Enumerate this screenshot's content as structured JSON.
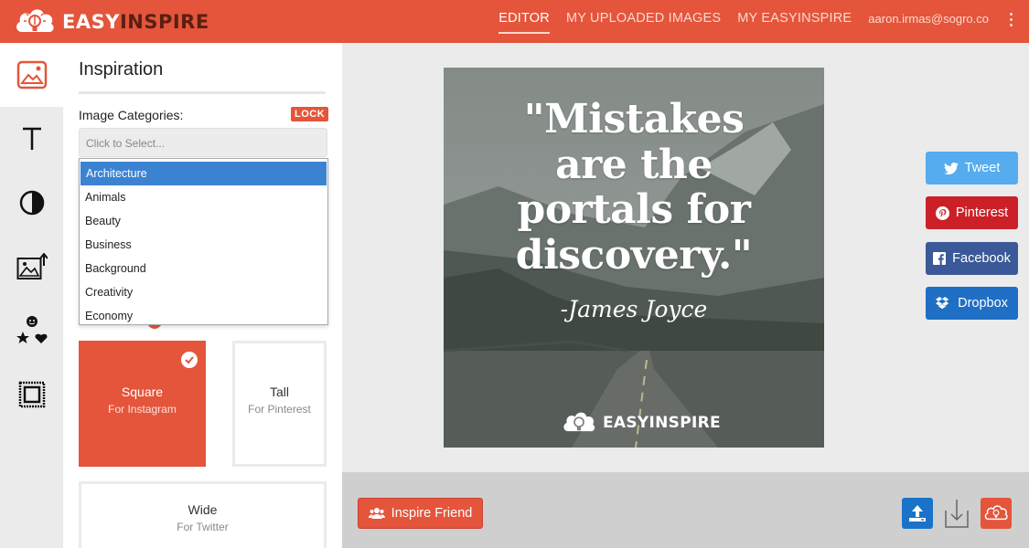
{
  "colors": {
    "brand": "#e4553b",
    "twitter": "#55acee",
    "pinterest": "#cb2027",
    "facebook": "#3b5998",
    "dropbox": "#1f6fc5",
    "upload": "#1a73c9"
  },
  "header": {
    "logo_text_light": "EASY",
    "logo_text_dark": "INSPIRE",
    "nav": [
      {
        "label": "EDITOR",
        "active": true
      },
      {
        "label": "MY UPLOADED IMAGES",
        "active": false
      },
      {
        "label": "MY EASYINSPIRE",
        "active": false
      }
    ],
    "user_email": "aaron.irmas@sogro.co",
    "menu_icon": "kebab-menu-icon"
  },
  "rail": [
    {
      "icon": "image-icon",
      "active": true
    },
    {
      "icon": "text-icon",
      "active": false
    },
    {
      "icon": "contrast-icon",
      "active": false
    },
    {
      "icon": "image-upload-icon",
      "active": false
    },
    {
      "icon": "stickers-icon",
      "active": false
    },
    {
      "icon": "frame-icon",
      "active": false
    }
  ],
  "panel": {
    "title": "Inspiration",
    "categories_label": "Image Categories:",
    "lock_label": "LOCK",
    "select_placeholder": "Click to Select...",
    "dropdown_options": [
      "Architecture",
      "Animals",
      "Beauty",
      "Business",
      "Background",
      "Creativity",
      "Economy"
    ],
    "dropdown_selected": "Architecture",
    "sizes": [
      {
        "name": "Square",
        "sub": "For Instagram",
        "selected": true
      },
      {
        "name": "Tall",
        "sub": "For Pinterest",
        "selected": false
      },
      {
        "name": "Wide",
        "sub": "For Twitter",
        "selected": false
      }
    ]
  },
  "canvas": {
    "quote": "\"Mistakes are the portals for discovery.\"",
    "quote_lines": [
      "\"Mistakes",
      "are the",
      "portals for",
      "discovery.\""
    ],
    "author": "-James Joyce",
    "watermark": "EASYINSPIRE"
  },
  "share": {
    "tweet": "Tweet",
    "pinterest": "Pinterest",
    "facebook": "Facebook",
    "dropbox": "Dropbox"
  },
  "bottom": {
    "inspire_friend": "Inspire Friend",
    "icons": [
      "upload-icon",
      "download-icon",
      "cloud-save-icon"
    ]
  }
}
